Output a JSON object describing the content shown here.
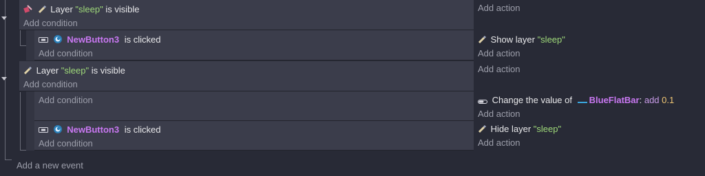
{
  "events": [
    {
      "condition": {
        "prefix": "Layer",
        "layer": "\"sleep\"",
        "suffix": "is visible"
      },
      "add_condition": "Add condition",
      "add_action": "Add action"
    },
    {
      "condition": {
        "object": "NewButton3",
        "suffix": "is clicked"
      },
      "add_condition": "Add condition",
      "action": {
        "prefix": "Show layer",
        "layer": "\"sleep\""
      },
      "add_action": "Add action"
    },
    {
      "condition": {
        "prefix": "Layer",
        "layer": "\"sleep\"",
        "suffix": "is visible"
      },
      "add_condition": "Add condition",
      "add_action": "Add action"
    },
    {
      "add_condition": "Add condition",
      "action": {
        "prefix": "Change the value of",
        "object": "BlueFlatBar",
        "sep": ":",
        "op": "add",
        "value": "0.1"
      },
      "add_action": "Add action"
    },
    {
      "condition": {
        "object": "NewButton3",
        "suffix": "is clicked"
      },
      "add_condition": "Add condition",
      "action": {
        "prefix": "Hide layer",
        "layer": "\"sleep\""
      },
      "add_action": "Add action"
    }
  ],
  "footer": {
    "add_event": "Add a new event"
  }
}
